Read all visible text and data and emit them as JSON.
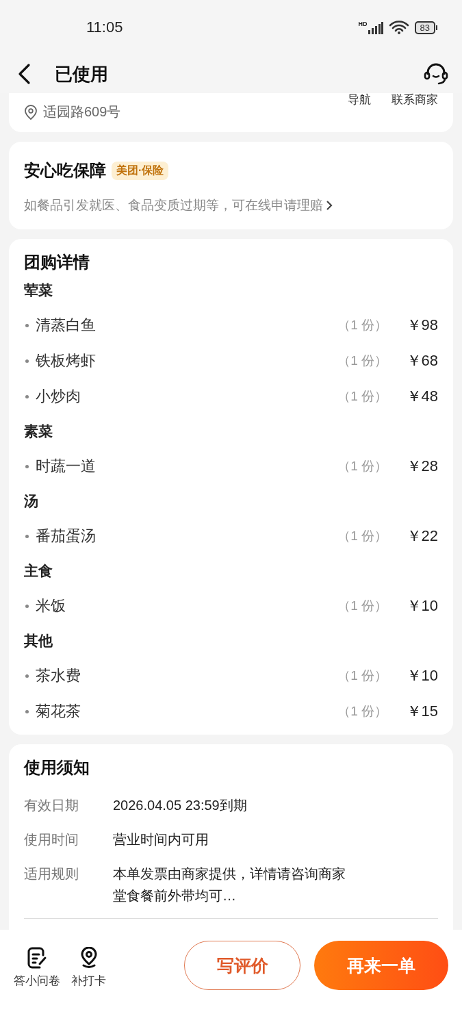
{
  "status_bar": {
    "time": "11:05",
    "network": "HD",
    "battery": "83"
  },
  "header": {
    "title": "已使用"
  },
  "store_card": {
    "address": "适园路609号",
    "actions": [
      "导航",
      "联系商家"
    ]
  },
  "guarantee": {
    "title": "安心吃保障",
    "badge": "美团·保险",
    "description": "如餐品引发就医、食品变质过期等，可在线申请理赔"
  },
  "deal": {
    "title": "团购详情",
    "groups": [
      {
        "name": "荤菜",
        "items": [
          {
            "name": "清蒸白鱼",
            "quantity": "（1 份）",
            "price": "￥98"
          },
          {
            "name": "铁板烤虾",
            "quantity": "（1 份）",
            "price": "￥68"
          },
          {
            "name": "小炒肉",
            "quantity": "（1 份）",
            "price": "￥48"
          }
        ]
      },
      {
        "name": "素菜",
        "items": [
          {
            "name": "时蔬一道",
            "quantity": "（1 份）",
            "price": "￥28"
          }
        ]
      },
      {
        "name": "汤",
        "items": [
          {
            "name": "番茄蛋汤",
            "quantity": "（1 份）",
            "price": "￥22"
          }
        ]
      },
      {
        "name": "主食",
        "items": [
          {
            "name": "米饭",
            "quantity": "（1 份）",
            "price": "￥10"
          }
        ]
      },
      {
        "name": "其他",
        "items": [
          {
            "name": "茶水费",
            "quantity": "（1 份）",
            "price": "￥10"
          },
          {
            "name": "菊花茶",
            "quantity": "（1 份）",
            "price": "￥15"
          }
        ]
      }
    ]
  },
  "notes": {
    "title": "使用须知",
    "rows": [
      {
        "label": "有效日期",
        "lines": [
          "2026.04.05 23:59到期"
        ]
      },
      {
        "label": "使用时间",
        "lines": [
          "营业时间内可用"
        ]
      },
      {
        "label": "适用规则",
        "lines": [
          "本单发票由商家提供，详情请咨询商家",
          "堂食餐前外带均可…"
        ]
      }
    ]
  },
  "bottom_bar": {
    "shortcuts": [
      {
        "kind": "survey",
        "label": "答小问卷"
      },
      {
        "kind": "checkin",
        "label": "补打卡"
      }
    ],
    "buttons": [
      {
        "kind": "outline",
        "label": "写评价"
      },
      {
        "kind": "primary",
        "label": "再来一单"
      }
    ]
  }
}
